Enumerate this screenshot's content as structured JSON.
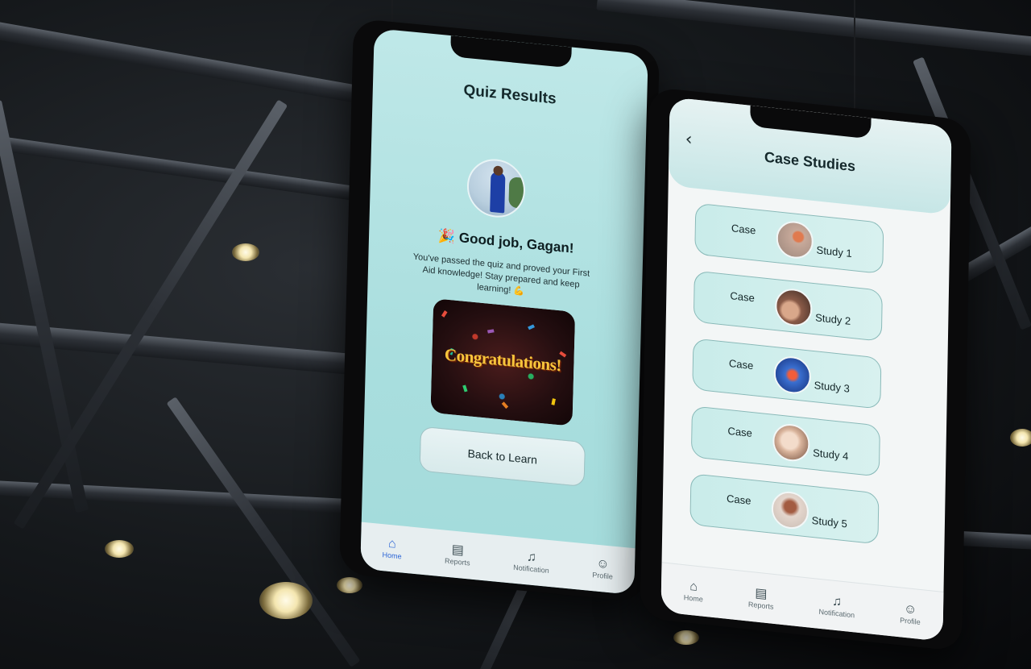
{
  "quiz_screen": {
    "title": "Quiz Results",
    "greeting": "🎉 Good job, Gagan!",
    "message": "You've passed the quiz and proved your First Aid knowledge! Stay prepared and keep learning! 💪",
    "banner_text": "Congratulations!",
    "back_button": "Back to Learn",
    "nav": [
      "Home",
      "Reports",
      "Notification",
      "Profile"
    ]
  },
  "case_screen": {
    "title": "Case Studies",
    "back_icon": "chevron-left-icon",
    "cases": [
      {
        "word1": "Case",
        "word2": "Study 1",
        "thumb_color": "#c7a99a"
      },
      {
        "word1": "Case",
        "word2": "Study 2",
        "thumb_color": "#8a5b48"
      },
      {
        "word1": "Case",
        "word2": "Study 3",
        "thumb_color": "#3a6fd0"
      },
      {
        "word1": "Case",
        "word2": "Study 4",
        "thumb_color": "#d9b49c"
      },
      {
        "word1": "Case",
        "word2": "Study 5",
        "thumb_color": "#e4d6cd"
      }
    ],
    "nav": [
      "Home",
      "Reports",
      "Notification",
      "Profile"
    ]
  },
  "colors": {
    "accent": "#2d66d6",
    "screen_bg": "#a9dede",
    "case_card": "#c9ecea"
  }
}
